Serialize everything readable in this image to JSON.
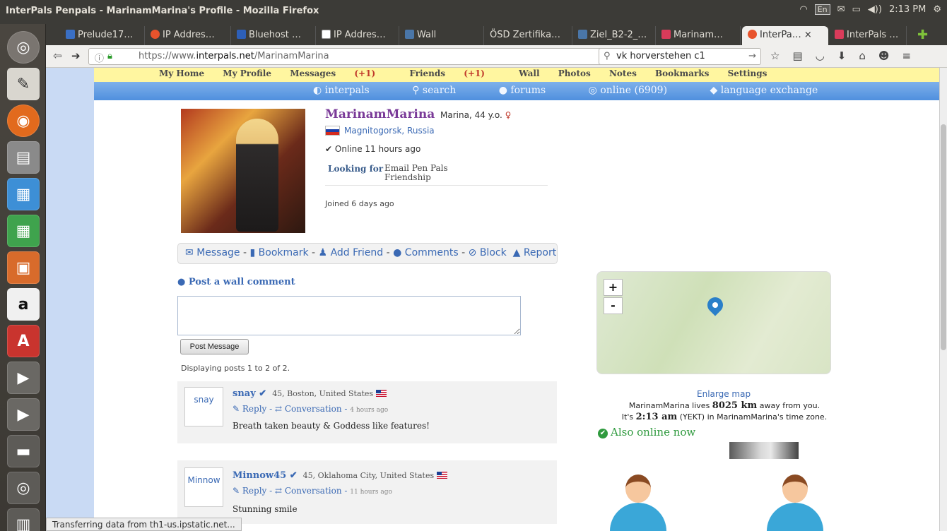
{
  "window": {
    "title": "InterPals Penpals - MarinamMarina's Profile - Mozilla Firefox"
  },
  "tray": {
    "keyboard": "En",
    "clock": "2:13 PM"
  },
  "tabs": [
    {
      "label": "Prelude17…",
      "icon_color": "#3a6fc4"
    },
    {
      "label": "IP Addres…",
      "icon_color": "#e8532c"
    },
    {
      "label": "Bluehost …",
      "icon_color": "#2d5fb8"
    },
    {
      "label": "IP Addres…",
      "icon_color": "#ffffff"
    },
    {
      "label": "Wall",
      "icon_color": "#4a76a8"
    },
    {
      "label": "ÖSD Zertifika…",
      "icon_color": "#3c3b37"
    },
    {
      "label": "Ziel_B2-2_…",
      "icon_color": "#4a76a8"
    },
    {
      "label": "Marinam…",
      "icon_color": "#d93b5a"
    },
    {
      "label": "InterPa…",
      "icon_color": "#e8532c",
      "active": true
    },
    {
      "label": "InterPals …",
      "icon_color": "#d93b5a"
    }
  ],
  "navbar": {
    "url_prefix": "https://www.",
    "url_domain": "interpals.net",
    "url_path": "/MarinamMarina",
    "search_value": "vk horverstehen c1"
  },
  "site_menu": {
    "home": "My Home",
    "profile": "My Profile",
    "messages": "Messages",
    "messages_count": "(+1)",
    "friends": "Friends",
    "friends_count": "(+1)",
    "wall": "Wall",
    "photos": "Photos",
    "notes": "Notes",
    "bookmarks": "Bookmarks",
    "settings": "Settings"
  },
  "blue_menu": {
    "logo": "interpals",
    "search": "search",
    "forums": "forums",
    "online": "online (6909)",
    "exchange": "language exchange"
  },
  "profile": {
    "username": "MarinamMarina",
    "info": "Marina, 44 y.o.",
    "city": "Magnitogorsk",
    "country": "Russia",
    "online": "Online 11 hours ago",
    "looking_label": "Looking for",
    "looking_1": "Email Pen Pals",
    "looking_2": "Friendship",
    "joined": "Joined 6 days ago"
  },
  "actions": {
    "message": "Message",
    "bookmark": "Bookmark",
    "add_friend": "Add Friend",
    "comments": "Comments",
    "block": "Block",
    "report": "Report"
  },
  "wall": {
    "title": "Post a wall comment",
    "button": "Post Message",
    "displaying": "Displaying posts 1 to 2 of 2."
  },
  "posts": [
    {
      "avatar": "snay",
      "user": "snay",
      "meta": "45, Boston, United States",
      "reply": "Reply",
      "conversation": "Conversation",
      "time": "4 hours ago",
      "body": "Breath taken beauty & Goddess like features!"
    },
    {
      "avatar": "Minnow",
      "user": "Minnow45",
      "meta": "45, Oklahoma City, United States",
      "reply": "Reply",
      "conversation": "Conversation",
      "time": "11 hours ago",
      "body": "Stunning smile"
    }
  ],
  "map": {
    "zoom_in": "+",
    "zoom_out": "-",
    "enlarge": "Enlarge map",
    "dist_pre": "MarinamMarina lives ",
    "dist_val": "8025 km",
    "dist_post": " away from you.",
    "time_pre": "It's ",
    "time_val": "2:13 am",
    "time_post": " (YEKT) in MarinamMarina's time zone."
  },
  "also_online": "Also online now",
  "status_bar": "Transferring data from th1-us.ipstatic.net..."
}
